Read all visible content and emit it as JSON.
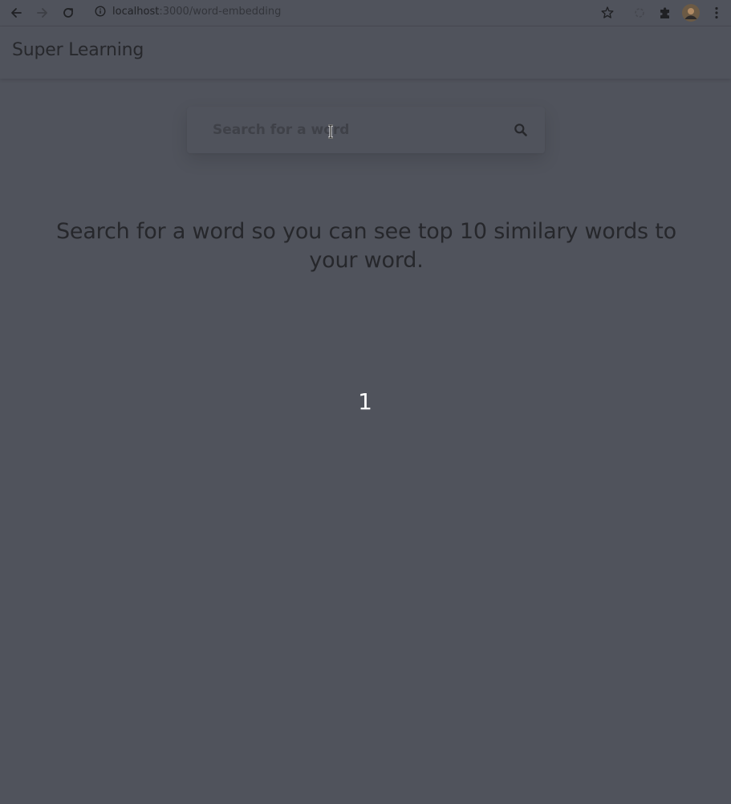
{
  "browser": {
    "url_host": "localhost",
    "url_path": ":3000/word-embedding"
  },
  "app": {
    "title": "Super Learning"
  },
  "search": {
    "placeholder": "Search for a word",
    "value": ""
  },
  "main": {
    "prompt": "Search for a word so you can see top 10 similary words to your word.",
    "page_number": "1"
  },
  "icons": {
    "back": "back-arrow-icon",
    "forward": "forward-arrow-icon",
    "reload": "reload-icon",
    "site_info": "info-icon",
    "bookmark": "star-icon",
    "extension": "puzzle-icon",
    "profile": "avatar",
    "menu": "kebab-menu-icon",
    "search": "search-icon"
  },
  "colors": {
    "background": "#50535c",
    "text": "#26272b",
    "page_number": "#ffffff"
  }
}
